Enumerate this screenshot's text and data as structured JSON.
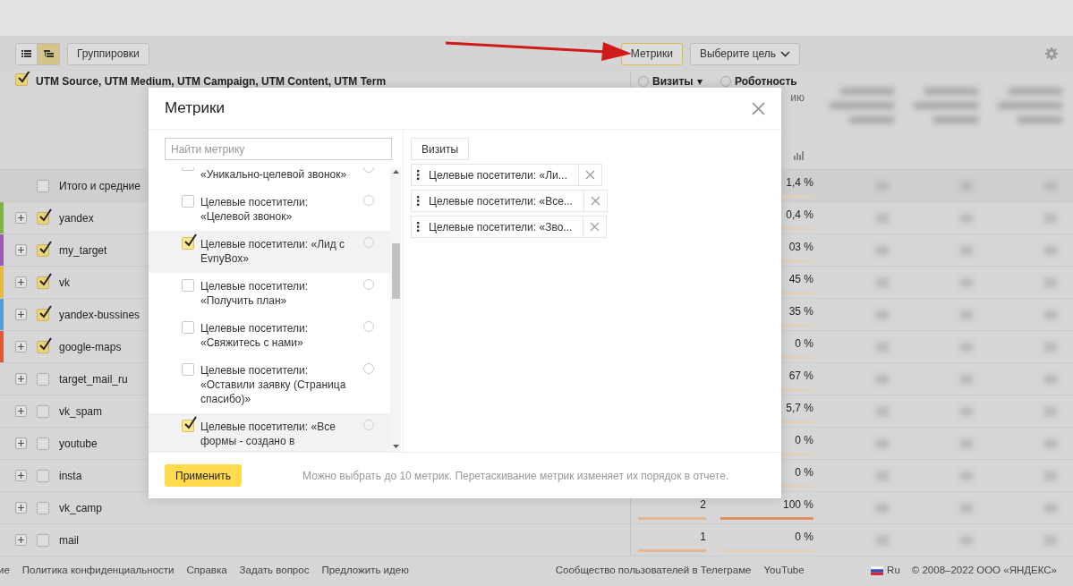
{
  "toolbar": {
    "view_buttons": [
      {
        "kind": "list",
        "selected": false
      },
      {
        "kind": "tree",
        "selected": true
      }
    ],
    "groupings_button": "Группировки",
    "metrics_button": {
      "label": "Метрики",
      "highlighted": true
    },
    "goal_dropdown": "Выберите цель"
  },
  "table": {
    "dimension_header": {
      "label": "UTM Source, UTM Medium, UTM Campaign, UTM Content, UTM Term",
      "checked": true
    },
    "columns": [
      {
        "label": "Визиты",
        "sort": "▾"
      },
      {
        "label": "Роботность",
        "sub": "ию"
      }
    ],
    "rows": [
      {
        "kind": "total",
        "label": "Итого и средние",
        "checked": false,
        "robot": "1,4 %"
      },
      {
        "kind": "group",
        "label": "yandex",
        "checked": true,
        "color": "#7fb347",
        "robot": "0,4 %"
      },
      {
        "kind": "group",
        "label": "my_target",
        "checked": true,
        "color": "#9a5bb5",
        "robot": "03 %"
      },
      {
        "kind": "group",
        "label": "vk",
        "checked": true,
        "color": "#e3b843",
        "robot": "45 %"
      },
      {
        "kind": "group",
        "label": "yandex-bussines",
        "checked": true,
        "color": "#5a9bd4",
        "robot": "35 %"
      },
      {
        "kind": "group",
        "label": "google-maps",
        "checked": true,
        "color": "#dd5a3c",
        "robot": "0 %"
      },
      {
        "kind": "group",
        "label": "target_mail_ru",
        "checked": false,
        "robot": "67 %"
      },
      {
        "kind": "group",
        "label": "vk_spam",
        "checked": false,
        "robot": "5,7 %"
      },
      {
        "kind": "group",
        "label": "youtube",
        "checked": false,
        "robot": "0 %"
      },
      {
        "kind": "group",
        "label": "insta",
        "checked": false,
        "robot": "0 %"
      },
      {
        "kind": "group",
        "label": "vk_camp",
        "checked": false,
        "visits": "2",
        "visits_bar": {
          "level": 1
        },
        "robot": "100 %",
        "robot_bar": {
          "level": 1
        }
      },
      {
        "kind": "group",
        "label": "mail",
        "checked": false,
        "visits": "1",
        "visits_bar": {
          "level": 1
        },
        "robot": "0 %",
        "robot_bar": {
          "level": 0
        }
      }
    ]
  },
  "modal": {
    "title": "Метрики",
    "search": {
      "placeholder": "Найти метрику"
    },
    "items": [
      {
        "text": "«Уникально-целевой звонок»",
        "checked": false
      },
      {
        "text": "Целевые посетители: «Целевой звонок»",
        "checked": false
      },
      {
        "text": "Целевые посетители: «Лид с EvnyBox»",
        "checked": true
      },
      {
        "text": "Целевые посетители: «Получить план»",
        "checked": false
      },
      {
        "text": "Целевые посетители: «Свяжитесь с нами»",
        "checked": false
      },
      {
        "text": "Целевые посетители: «Оставили заявку (Страница спасибо)»",
        "checked": false
      },
      {
        "text": "Целевые посетители: «Все формы - создано в",
        "checked": true
      }
    ],
    "chips": [
      {
        "kind": "fixed",
        "label": "Визиты"
      },
      {
        "kind": "removable",
        "label": "Целевые посетители: «Ли..."
      },
      {
        "kind": "removable",
        "label": "Целевые посетители: «Все..."
      },
      {
        "kind": "removable",
        "label": "Целевые посетители: «Зво..."
      }
    ],
    "apply_button": "Применить",
    "hint": "Можно выбрать до 10 метрик. Перетаскивание метрик изменяет их порядок в отчете."
  },
  "footer": {
    "left_links": [
      "ие",
      "Политика конфиденциальности",
      "Справка",
      "Задать вопрос",
      "Предложить идею"
    ],
    "center_links": [
      "Сообщество пользователей в Телеграме",
      "YouTube"
    ],
    "language": "Ru",
    "copyright": "© 2008–2022 ООО «ЯНДЕКС»"
  }
}
